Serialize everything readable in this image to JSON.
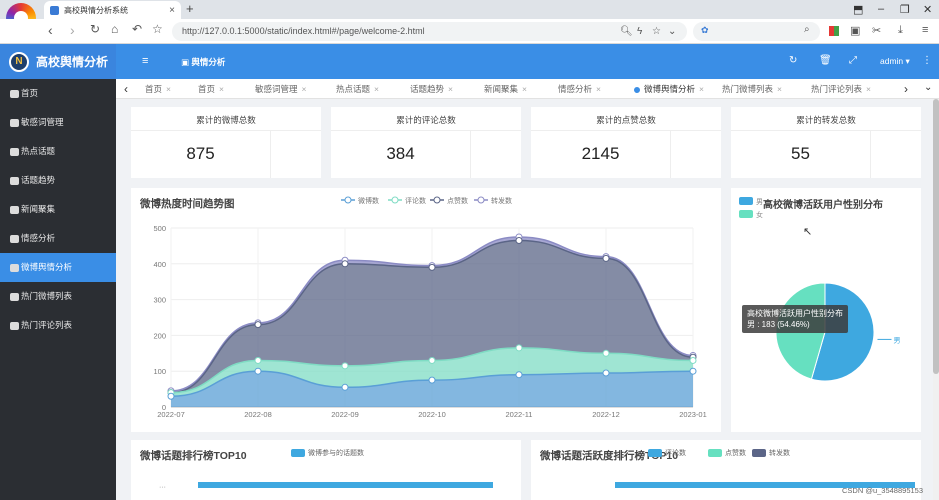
{
  "browser": {
    "tab_title": "高校舆情分析系统",
    "url": "http://127.0.0.1:5000/static/index.html#/page/welcome-2.html"
  },
  "app": {
    "logo_text": "高校舆情分析",
    "header_module": "舆情分析",
    "user": "admin"
  },
  "sidebar": {
    "items": [
      {
        "label": "首页"
      },
      {
        "label": "敏感词管理"
      },
      {
        "label": "热点话题"
      },
      {
        "label": "话题趋势"
      },
      {
        "label": "新闻聚集"
      },
      {
        "label": "情感分析"
      },
      {
        "label": "微博舆情分析"
      },
      {
        "label": "热门微博列表"
      },
      {
        "label": "热门评论列表"
      }
    ]
  },
  "page_tabs": [
    {
      "label": "首页"
    },
    {
      "label": "首页"
    },
    {
      "label": "敏感词管理"
    },
    {
      "label": "热点话题"
    },
    {
      "label": "话题趋势"
    },
    {
      "label": "新闻聚集"
    },
    {
      "label": "情感分析"
    },
    {
      "label": "微博舆情分析"
    },
    {
      "label": "热门微博列表"
    },
    {
      "label": "热门评论列表"
    }
  ],
  "stats": [
    {
      "label": "累计的微博总数",
      "value": "875"
    },
    {
      "label": "累计的评论总数",
      "value": "384"
    },
    {
      "label": "累计的点赞总数",
      "value": "2145"
    },
    {
      "label": "累计的转发总数",
      "value": "55"
    }
  ],
  "chart_data": [
    {
      "type": "area",
      "title": "微博热度时间趋势图",
      "categories": [
        "2022-07",
        "2022-08",
        "2022-09",
        "2022-10",
        "2022-11",
        "2022-12",
        "2023-01"
      ],
      "ylim": [
        0,
        500
      ],
      "yticks": [
        "0",
        "100",
        "200",
        "300",
        "400",
        "500"
      ],
      "legend_position": "top",
      "stacked": true,
      "series": [
        {
          "name": "微博数",
          "values": [
            30,
            100,
            55,
            75,
            90,
            95,
            100
          ],
          "color": "#5a9fd6"
        },
        {
          "name": "评论数",
          "values": [
            10,
            30,
            60,
            55,
            75,
            55,
            30
          ],
          "color": "#7fdcc4"
        },
        {
          "name": "点赞数",
          "values": [
            0,
            100,
            285,
            260,
            300,
            265,
            9
          ],
          "color": "#5b6587"
        },
        {
          "name": "转发数",
          "values": [
            5,
            5,
            10,
            5,
            10,
            5,
            5
          ],
          "color": "#8b8bc4"
        }
      ]
    },
    {
      "type": "pie",
      "title": "高校微博活跃用户性别分布",
      "legend_position": "top-left",
      "slices": [
        {
          "name": "男",
          "value": 183,
          "color": "#3ea8e0"
        },
        {
          "name": "女",
          "value": 153,
          "color": "#66e0c0"
        }
      ],
      "tooltip": {
        "title": "高校微博活跃用户性别分布",
        "line": "男 : 183 (54.46%)"
      }
    },
    {
      "type": "bar",
      "title": "微博话题排行榜TOP10",
      "legend_position": "top",
      "series": [
        {
          "name": "微博参与的话题数",
          "color": "#3ea8e0"
        }
      ]
    },
    {
      "type": "bar",
      "title": "微博话题活跃度排行榜TOP10",
      "legend_position": "top",
      "series": [
        {
          "name": "评论数",
          "color": "#3ea8e0"
        },
        {
          "name": "点赞数",
          "color": "#66e0c0"
        },
        {
          "name": "转发数",
          "color": "#5b6587"
        }
      ]
    }
  ],
  "watermark": "CSDN @u_3548895153"
}
